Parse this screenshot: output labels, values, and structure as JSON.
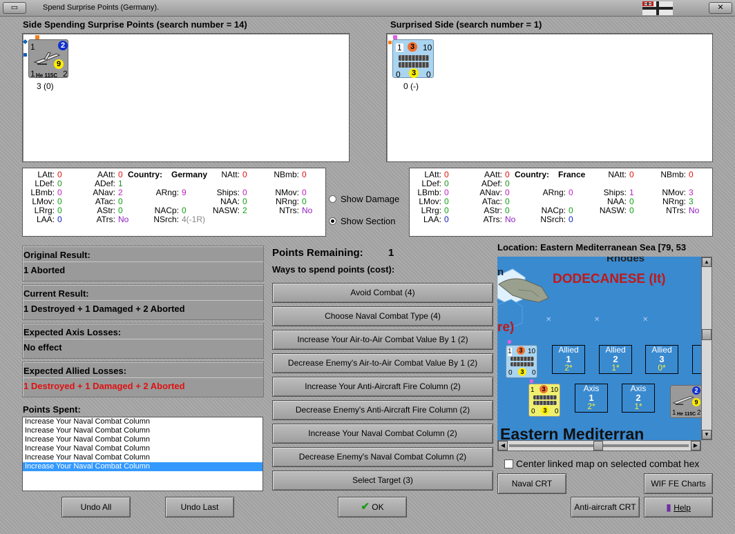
{
  "window": {
    "title": "Spend Surprise Points (Germany).",
    "close_glyph": "✕"
  },
  "left_header": "Side Spending Surprise Points (search number = 14)",
  "right_header": "Surprised Side (search number = 1)",
  "ger_unit": {
    "top_left": "1",
    "top_right": "2",
    "mid": "9",
    "bottom_left": "1",
    "bottom_right": "2",
    "name": "He 115C",
    "caption": "3 (0)"
  },
  "fr_unit": {
    "a": "1",
    "b": "3",
    "c": "10",
    "d": "0",
    "e": "3",
    "f": "0",
    "caption": "0 (-)"
  },
  "stats_left": {
    "country_label": "Country:",
    "country": "Germany",
    "rows": [
      [
        [
          "LAtt:",
          "0"
        ],
        [
          "AAtt:",
          "0"
        ],
        [
          "",
          ""
        ],
        [
          "NAtt:",
          "0"
        ],
        [
          "NBmb:",
          "0"
        ]
      ],
      [
        [
          "LDef:",
          "0"
        ],
        [
          "ADef:",
          "1"
        ],
        [
          "",
          ""
        ],
        [
          "",
          ""
        ],
        [
          "",
          ""
        ]
      ],
      [
        [
          "LBmb:",
          "0"
        ],
        [
          "ANav:",
          "2"
        ],
        [
          "ARng:",
          "9"
        ],
        [
          "Ships:",
          "0"
        ],
        [
          "NMov:",
          "0"
        ]
      ],
      [
        [
          "LMov:",
          "0"
        ],
        [
          "ATac:",
          "0"
        ],
        [
          "",
          ""
        ],
        [
          "NAA:",
          "0"
        ],
        [
          "NRng:",
          "0"
        ]
      ],
      [
        [
          "LRrg:",
          "0"
        ],
        [
          "AStr:",
          "0"
        ],
        [
          "NACp:",
          "0"
        ],
        [
          "NASW:",
          "2"
        ],
        [
          "NTrs:",
          "No"
        ]
      ],
      [
        [
          "LAA:",
          "0"
        ],
        [
          "ATrs:",
          "No"
        ],
        [
          "NSrch:",
          "4(-1R)"
        ],
        [
          "",
          ""
        ],
        [
          "",
          ""
        ]
      ]
    ]
  },
  "stats_right": {
    "country_label": "Country:",
    "country": "France",
    "rows": [
      [
        [
          "LAtt:",
          "0"
        ],
        [
          "AAtt:",
          "0"
        ],
        [
          "",
          ""
        ],
        [
          "NAtt:",
          "0"
        ],
        [
          "NBmb:",
          "0"
        ]
      ],
      [
        [
          "LDef:",
          "0"
        ],
        [
          "ADef:",
          "0"
        ],
        [
          "",
          ""
        ],
        [
          "",
          ""
        ],
        [
          "",
          ""
        ]
      ],
      [
        [
          "LBmb:",
          "0"
        ],
        [
          "ANav:",
          "0"
        ],
        [
          "ARng:",
          "0"
        ],
        [
          "Ships:",
          "1"
        ],
        [
          "NMov:",
          "3"
        ]
      ],
      [
        [
          "LMov:",
          "0"
        ],
        [
          "ATac:",
          "0"
        ],
        [
          "",
          ""
        ],
        [
          "NAA:",
          "0"
        ],
        [
          "NRng:",
          "3"
        ]
      ],
      [
        [
          "LRrg:",
          "0"
        ],
        [
          "AStr:",
          "0"
        ],
        [
          "NACp:",
          "0"
        ],
        [
          "NASW:",
          "0"
        ],
        [
          "NTrs:",
          "No"
        ]
      ],
      [
        [
          "LAA:",
          "0"
        ],
        [
          "ATrs:",
          "No"
        ],
        [
          "NSrch:",
          "0"
        ],
        [
          "",
          ""
        ],
        [
          "",
          ""
        ]
      ]
    ]
  },
  "options": {
    "show_damage": "Show Damage",
    "show_section": "Show Section",
    "selected": "show_section"
  },
  "results": [
    {
      "heading": "Original Result:",
      "text": "1 Aborted",
      "color": "#000000"
    },
    {
      "heading": "Current Result:",
      "text": "1 Destroyed + 1 Damaged + 2 Aborted",
      "color": "#000000"
    },
    {
      "heading": "Expected Axis Losses:",
      "text": "No effect",
      "color": "#000000"
    },
    {
      "heading": "Expected Allied Losses:",
      "text": "1 Destroyed + 1 Damaged + 2 Aborted",
      "color": "#e01010"
    }
  ],
  "points_spent_label": "Points Spent:",
  "points_spent": [
    "Increase Your Naval Combat Column",
    "Increase Your Naval Combat Column",
    "Increase Your Naval Combat Column",
    "Increase Your Naval Combat Column",
    "Increase Your Naval Combat Column",
    "Increase Your Naval Combat Column"
  ],
  "points_remaining_label": "Points Remaining:",
  "points_remaining": "1",
  "ways_label": "Ways to spend points (cost):",
  "ways": [
    "Avoid Combat (4)",
    "Choose Naval Combat Type (4)",
    "Increase Your Air-to-Air Combat Value By 1 (2)",
    "Decrease Enemy's Air-to-Air Combat Value By 1 (2)",
    "Increase Your Anti-Aircraft Fire Column (2)",
    "Decrease Enemy's Anti-Aircraft Fire Column (2)",
    "Increase Your Naval Combat Column (2)",
    "Decrease Enemy's Naval Combat Column (2)",
    "Select Target (3)"
  ],
  "location": "Location: Eastern Mediterranean Sea [79, 53",
  "map": {
    "rhodes": "Rhodes",
    "dodecanese": "DODECANESE (It)",
    "n": "n",
    "re": "re)",
    "sea_label": "Eastern Mediterran",
    "allied": [
      {
        "title": "Allied",
        "n": "1",
        "v": "2*"
      },
      {
        "title": "Allied",
        "n": "2",
        "v": "1*"
      },
      {
        "title": "Allied",
        "n": "3",
        "v": "0*"
      }
    ],
    "axis": [
      {
        "title": "Axis",
        "n": "1",
        "v": "2*"
      },
      {
        "title": "Axis",
        "n": "2",
        "v": "1*"
      }
    ]
  },
  "center_linked": "Center linked map on selected combat hex",
  "buttons": {
    "naval_crt": "Naval CRT",
    "wif_charts": "WIF FE Charts",
    "aa_crt": "Anti-aircraft CRT",
    "help": "Help",
    "undo_all": "Undo All",
    "undo_last": "Undo Last",
    "ok": "OK"
  }
}
